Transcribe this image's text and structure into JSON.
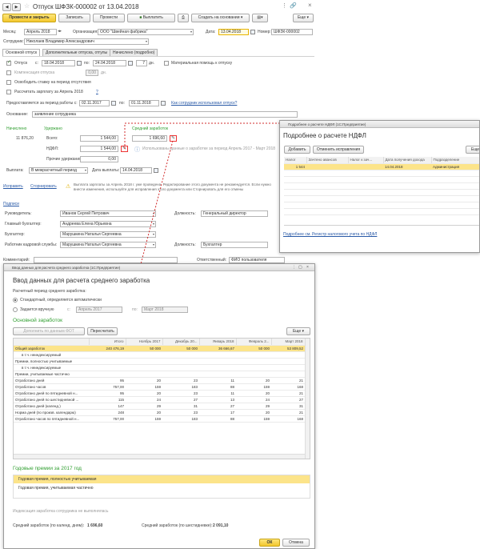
{
  "main": {
    "title": "Отпуск ШФЗК-000002 от 13.04.2018",
    "toolbar": {
      "post_close": "Провести и закрыть",
      "save": "Записать",
      "post": "Провести",
      "pay": "Выплатить",
      "create_base": "Создать на основании",
      "more": "Еще"
    },
    "header": {
      "month_label": "Месяц:",
      "month_value": "Апрель 2018",
      "org_label": "Организация:",
      "org_value": "ООО \"Швейная фабрика\"",
      "date_label": "Дата:",
      "date_value": "13.04.2018",
      "number_label": "Номер:",
      "number_value": "ШФЗК-000002",
      "employee_label": "Сотрудник:",
      "employee_value": "Николаев Владимир Александрович"
    },
    "tabs": [
      "Основной отпуск",
      "Дополнительные отпуска, отгулы",
      "Начислено (подробно)"
    ],
    "vac": {
      "otpusk": "Отпуск",
      "s": "с:",
      "from": "18.04.2018",
      "po": "по:",
      "to": "24.04.2018",
      "days": "7",
      "dn": "дн.",
      "material_help": "Материальная помощь к отпуску",
      "compensation": "Компенсация отпуска",
      "comp_days": "0,00",
      "comp_dn": "дн.",
      "free_rate": "Освободить ставку на период отсутствия",
      "calc_salary": "Рассчитать зарплату за Апрель 2018",
      "help": "?",
      "provided_label": "Предоставляется за период работы с:",
      "prov_from": "02.11.2017",
      "prov_po": "по:",
      "prov_to": "01.11.2018",
      "how_link": "Как сотрудник использовал отпуск?",
      "basis_label": "Основание:",
      "basis_value": "заявление сотрудника"
    },
    "totals": {
      "accrued_label": "Начислено",
      "withheld_label": "Удержано",
      "avg_label": "Средний заработок",
      "accrued": "11 876,20",
      "total_label": "Всего:",
      "total": "1 544,00",
      "avg": "1 696,60",
      "ndfl_label": "НДФЛ:",
      "ndfl": "1 544,00",
      "other_label": "Прочие удержания:",
      "other": "0,00",
      "avg_note": "Использованы данные о заработке за период Апрель 2017 - Март 2018",
      "payout_label": "Выплата:",
      "payout_value": "В межрасчетный период",
      "payout_date_label": "Дата выплаты:",
      "payout_date": "14.04.2018"
    },
    "fix_link": "Исправить",
    "reverse_link": "Сторнировать",
    "warning": "Выплата зарплаты за Апрель 2018 г. уже проведена. Редактирование этого документа не рекомендуется. Если нужно внести изменения, используйте для исправления этого документа или Сторнировать для его отмены",
    "signatures": {
      "section": "Подписи",
      "head_label": "Руководитель:",
      "head_value": "Иванов Сергей Петрович",
      "head_pos_label": "Должность:",
      "head_pos_value": "Генеральный директор",
      "chief_acc_label": "Главный бухгалтер:",
      "chief_acc_value": "Андреева Елена Юрьевна",
      "acc_label": "Бухгалтер:",
      "acc_value": "Марушкина Наталья Сергеевна",
      "hr_label": "Работник кадровой службы:",
      "hr_value": "Марушкина Наталья Сергеевна",
      "hr_pos_label": "Должность:",
      "hr_pos_value": "Бухгалтер"
    },
    "comment_label": "Комментарий:",
    "responsible_label": "Ответственный:",
    "responsible_value": "ФИО пользователя"
  },
  "ndfl": {
    "titlebar": "Подробнее о расчете НДФЛ (1С:Предприятие)",
    "title": "Подробнее о расчете НДФЛ",
    "add": "Добавить",
    "cancel_fix": "Отменить исправления",
    "more": "Еще",
    "columns": [
      "Налог",
      "Зачтено авансов",
      "Налог к зач...",
      "Дата получения дохода",
      "Подразделение"
    ],
    "rows": [
      [
        "1 544",
        "",
        "",
        "14.04.2018",
        "Администрация"
      ]
    ],
    "register_link": "Подробнее см. Регистр налогового учета по НДФЛ"
  },
  "avg": {
    "titlebar": "Ввод данных для расчета среднего заработка (1С:Предприятие)",
    "title": "Ввод данных для расчета среднего заработка",
    "period_label": "Расчетный период среднего заработка:",
    "standard": "Стандартный, определяется автоматически",
    "manual": "Задается вручную",
    "s": "с:",
    "from": "Апрель 2017",
    "po": "по:",
    "to": "Март 2018",
    "main_section": "Основной заработок",
    "fill_btn": "Дополнить по данным ФОТ",
    "recalc_btn": "Пересчитать",
    "more": "Еще",
    "columns": [
      "",
      "Итого",
      "Ноябрь 2017",
      "Декабрь 20...",
      "Январь 2018",
      "Февраль 2...",
      "Март 2018"
    ],
    "rows": [
      [
        "Общий заработок",
        "240 476,19",
        "50 000",
        "50 000",
        "36 666,67",
        "50 000",
        "53 809,52"
      ],
      [
        "в т.ч. неиндексируемый",
        "",
        "",
        "",
        "",
        "",
        ""
      ],
      [
        "Премии, полностью учитываемые",
        "",
        "",
        "",
        "",
        "",
        ""
      ],
      [
        "в т.ч. неиндексируемые",
        "",
        "",
        "",
        "",
        "",
        ""
      ],
      [
        "Премии, учитываемые частично",
        "",
        "",
        "",
        "",
        "",
        ""
      ],
      [
        "Отработано дней",
        "95",
        "20",
        "23",
        "11",
        "20",
        "21"
      ],
      [
        "Отработано часов",
        "757,00",
        "159",
        "183",
        "88",
        "159",
        "168"
      ],
      [
        "Отработано дней по пятидневной н...",
        "95",
        "20",
        "23",
        "11",
        "20",
        "21"
      ],
      [
        "Отработано дней по шестидневной ...",
        "115",
        "24",
        "27",
        "13",
        "24",
        "27"
      ],
      [
        "Отработано дней (календ.)",
        "147",
        "29",
        "31",
        "27",
        "29",
        "31"
      ],
      [
        "Норма дней (по произв. календарю)",
        "248",
        "20",
        "23",
        "17",
        "20",
        "21"
      ],
      [
        "Отработано часов по пятидневной н...",
        "757,00",
        "159",
        "183",
        "88",
        "159",
        "168"
      ]
    ],
    "bonus_section": "Годовые премии за 2017 год",
    "bonus_rows": [
      "Годовая премия, полностью учитываемая",
      "Годовая премия, учитываемая частично"
    ],
    "indexation_note": "Индексация заработка сотрудника не выполнялась",
    "avg_cal_label": "Средний заработок (по календ. дням):",
    "avg_cal_value": "1 696,60",
    "avg_six_label": "Средний заработок (по шестидневке):",
    "avg_six_value": "2 091,10",
    "ok": "ОК",
    "cancel": "Отмена"
  },
  "colors": {
    "accent_yellow": "#fce48a",
    "link_red": "#d12c2c",
    "green": "#2f9e2f"
  }
}
